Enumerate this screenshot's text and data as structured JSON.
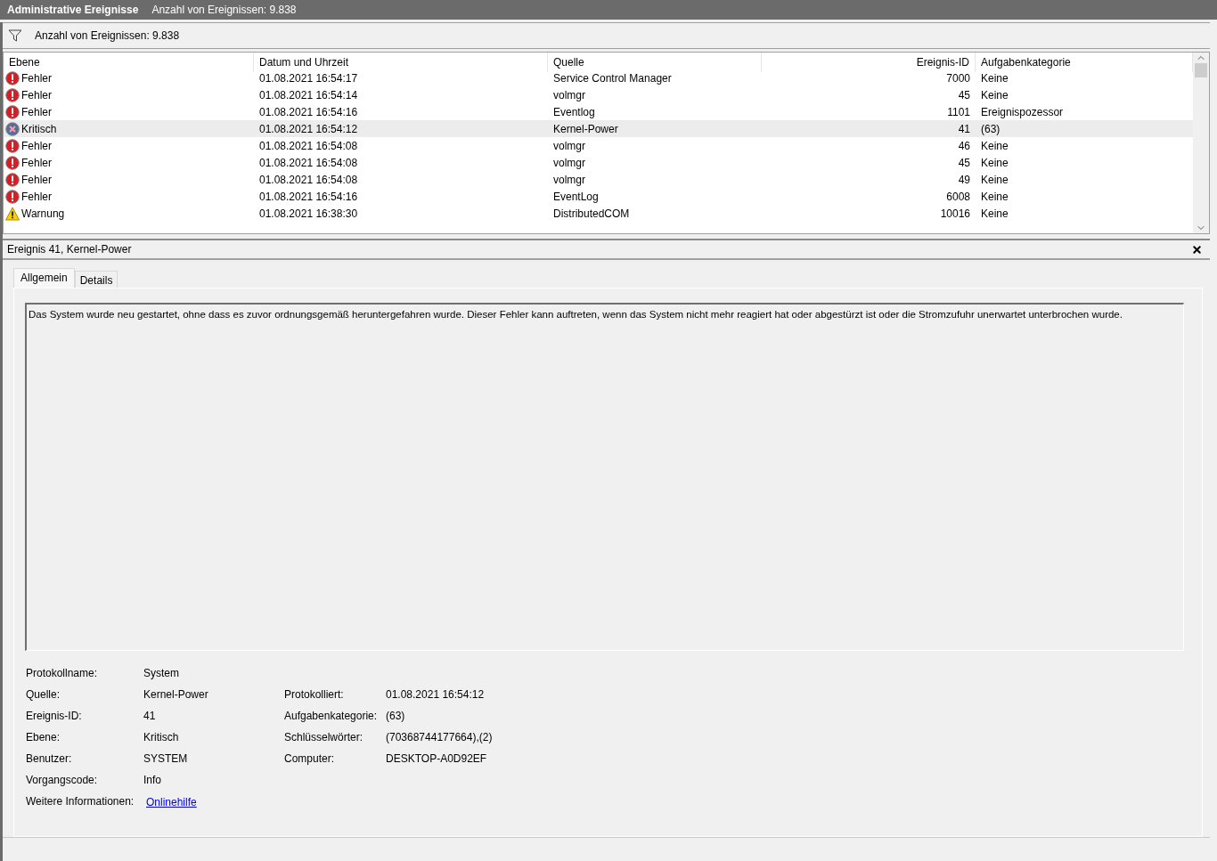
{
  "title_bar": {
    "title": "Administrative Ereignisse",
    "count": "Anzahl von Ereignissen: 9.838"
  },
  "filter_bar": {
    "text": "Anzahl von Ereignissen: 9.838"
  },
  "table": {
    "columns": [
      "Ebene",
      "Datum und Uhrzeit",
      "Quelle",
      "Ereignis-ID",
      "Aufgabenkategorie"
    ],
    "rows": [
      {
        "kind": "error",
        "level": "Fehler",
        "date": "01.08.2021 16:54:17",
        "source": "Service Control Manager",
        "id": "7000",
        "category": "Keine",
        "selected": false
      },
      {
        "kind": "error",
        "level": "Fehler",
        "date": "01.08.2021 16:54:14",
        "source": "volmgr",
        "id": "45",
        "category": "Keine",
        "selected": false
      },
      {
        "kind": "error",
        "level": "Fehler",
        "date": "01.08.2021 16:54:16",
        "source": "Eventlog",
        "id": "1101",
        "category": "Ereignispozessor",
        "selected": false
      },
      {
        "kind": "critical",
        "level": "Kritisch",
        "date": "01.08.2021 16:54:12",
        "source": "Kernel-Power",
        "id": "41",
        "category": "(63)",
        "selected": true
      },
      {
        "kind": "error",
        "level": "Fehler",
        "date": "01.08.2021 16:54:08",
        "source": "volmgr",
        "id": "46",
        "category": "Keine",
        "selected": false
      },
      {
        "kind": "error",
        "level": "Fehler",
        "date": "01.08.2021 16:54:08",
        "source": "volmgr",
        "id": "45",
        "category": "Keine",
        "selected": false
      },
      {
        "kind": "error",
        "level": "Fehler",
        "date": "01.08.2021 16:54:08",
        "source": "volmgr",
        "id": "49",
        "category": "Keine",
        "selected": false
      },
      {
        "kind": "error",
        "level": "Fehler",
        "date": "01.08.2021 16:54:16",
        "source": "EventLog",
        "id": "6008",
        "category": "Keine",
        "selected": false
      },
      {
        "kind": "warning",
        "level": "Warnung",
        "date": "01.08.2021 16:38:30",
        "source": "DistributedCOM",
        "id": "10016",
        "category": "Keine",
        "selected": false
      }
    ]
  },
  "detail": {
    "title": "Ereignis 41, Kernel-Power",
    "tabs": [
      {
        "label": "Allgemein",
        "selected": true
      },
      {
        "label": "Details",
        "selected": false
      }
    ],
    "description": "Das System wurde neu gestartet, ohne dass es zuvor ordnungsgemäß heruntergefahren wurde. Dieser Fehler kann auftreten, wenn das System nicht mehr reagiert hat oder abgestürzt ist oder die Stromzufuhr unerwartet unterbrochen wurde.",
    "fields_left": [
      {
        "label": "Protokollname:",
        "value": "System"
      },
      {
        "label": "Quelle:",
        "value": "Kernel-Power"
      },
      {
        "label": "Ereignis-ID:",
        "value": "41"
      },
      {
        "label": "Ebene:",
        "value": "Kritisch"
      },
      {
        "label": "Benutzer:",
        "value": "SYSTEM"
      },
      {
        "label": "Vorgangscode:",
        "value": "Info"
      },
      {
        "label": "Weitere Informationen:",
        "value": "Onlinehilfe",
        "kind": "link"
      }
    ],
    "fields_right": [
      {
        "label": "Protokolliert:",
        "value": "01.08.2021 16:54:12"
      },
      {
        "label": "Aufgabenkategorie:",
        "value": "(63)"
      },
      {
        "label": "Schlüsselwörter:",
        "value": "(70368744177664),(2)"
      },
      {
        "label": "Computer:",
        "value": "DESKTOP-A0D92EF"
      }
    ]
  }
}
